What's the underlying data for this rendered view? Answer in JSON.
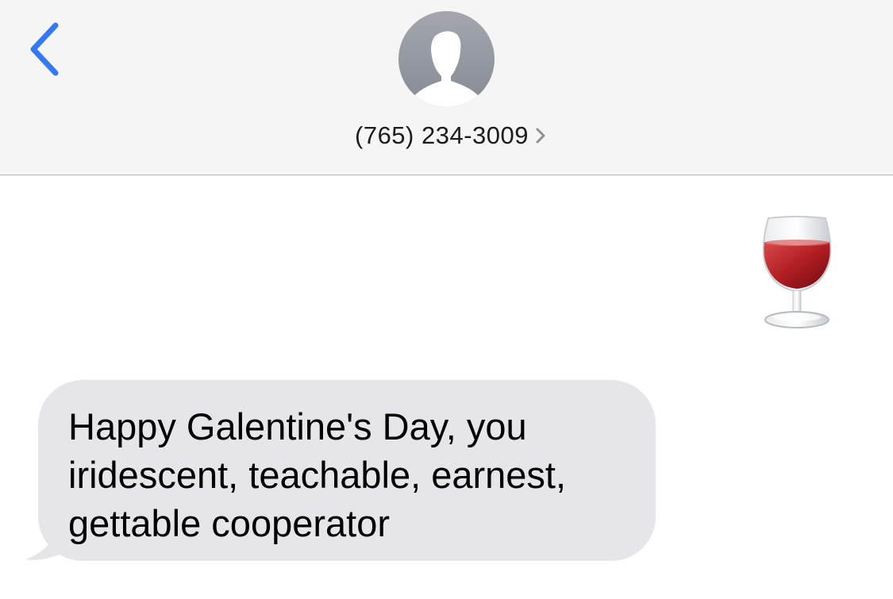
{
  "header": {
    "back_icon": "chevron-left-icon",
    "avatar_icon": "person-silhouette-icon",
    "contact_name": "(765) 234-3009",
    "contact_chevron_icon": "chevron-right-icon",
    "accent_color": "#3478f6"
  },
  "thread": {
    "messages": [
      {
        "direction": "outgoing",
        "type": "emoji",
        "content": "wine-glass-emoji"
      },
      {
        "direction": "incoming",
        "type": "text",
        "lines": [
          "Happy Galentine's Day, you",
          "iridescent, teachable, earnest,",
          "gettable cooperator"
        ],
        "bubble_color": "#e5e5ea"
      }
    ]
  }
}
